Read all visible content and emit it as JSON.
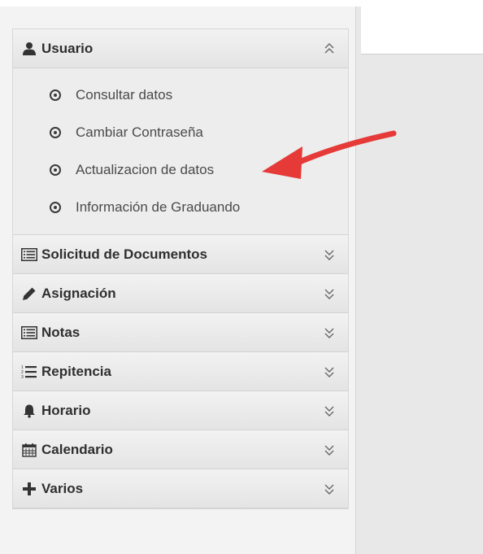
{
  "colors": {
    "page_bg": "#e8e8e8",
    "sidebar_bg": "#f3f3f3",
    "header_gradient_top": "#f2f2f2",
    "header_gradient_bottom": "#e4e4e4",
    "text": "#2f2f2f",
    "annotation_arrow": "#e53a37"
  },
  "menu": {
    "open_section": {
      "title": "Usuario",
      "icon": "user-icon",
      "state": "expanded",
      "items": [
        {
          "label": "Consultar datos"
        },
        {
          "label": "Cambiar Contraseña"
        },
        {
          "label": "Actualizacion de datos"
        },
        {
          "label": "Información de Graduando"
        }
      ]
    },
    "sections": [
      {
        "title": "Solicitud de Documentos",
        "icon": "list-icon",
        "state": "collapsed"
      },
      {
        "title": "Asignación",
        "icon": "pencil-icon",
        "state": "collapsed"
      },
      {
        "title": "Notas",
        "icon": "list-icon",
        "state": "collapsed"
      },
      {
        "title": "Repitencia",
        "icon": "ordered-list-icon",
        "state": "collapsed"
      },
      {
        "title": "Horario",
        "icon": "bell-icon",
        "state": "collapsed"
      },
      {
        "title": "Calendario",
        "icon": "calendar-icon",
        "state": "collapsed"
      },
      {
        "title": "Varios",
        "icon": "plus-icon",
        "state": "collapsed"
      }
    ]
  },
  "annotation": {
    "type": "arrow",
    "points_to": "Actualizacion de datos",
    "color": "#e53a37"
  }
}
